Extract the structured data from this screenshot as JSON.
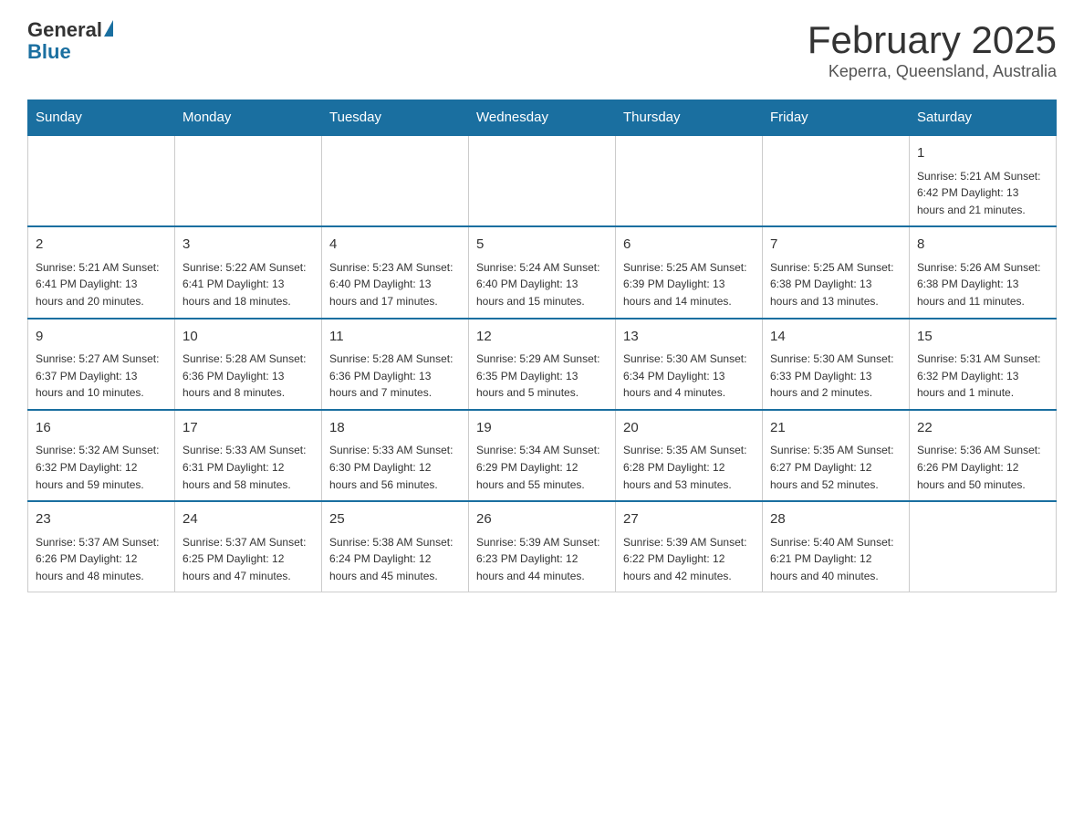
{
  "header": {
    "logo_general": "General",
    "logo_blue": "Blue",
    "title": "February 2025",
    "location": "Keperra, Queensland, Australia"
  },
  "weekdays": [
    "Sunday",
    "Monday",
    "Tuesday",
    "Wednesday",
    "Thursday",
    "Friday",
    "Saturday"
  ],
  "weeks": [
    [
      {
        "day": "",
        "info": ""
      },
      {
        "day": "",
        "info": ""
      },
      {
        "day": "",
        "info": ""
      },
      {
        "day": "",
        "info": ""
      },
      {
        "day": "",
        "info": ""
      },
      {
        "day": "",
        "info": ""
      },
      {
        "day": "1",
        "info": "Sunrise: 5:21 AM\nSunset: 6:42 PM\nDaylight: 13 hours and 21 minutes."
      }
    ],
    [
      {
        "day": "2",
        "info": "Sunrise: 5:21 AM\nSunset: 6:41 PM\nDaylight: 13 hours and 20 minutes."
      },
      {
        "day": "3",
        "info": "Sunrise: 5:22 AM\nSunset: 6:41 PM\nDaylight: 13 hours and 18 minutes."
      },
      {
        "day": "4",
        "info": "Sunrise: 5:23 AM\nSunset: 6:40 PM\nDaylight: 13 hours and 17 minutes."
      },
      {
        "day": "5",
        "info": "Sunrise: 5:24 AM\nSunset: 6:40 PM\nDaylight: 13 hours and 15 minutes."
      },
      {
        "day": "6",
        "info": "Sunrise: 5:25 AM\nSunset: 6:39 PM\nDaylight: 13 hours and 14 minutes."
      },
      {
        "day": "7",
        "info": "Sunrise: 5:25 AM\nSunset: 6:38 PM\nDaylight: 13 hours and 13 minutes."
      },
      {
        "day": "8",
        "info": "Sunrise: 5:26 AM\nSunset: 6:38 PM\nDaylight: 13 hours and 11 minutes."
      }
    ],
    [
      {
        "day": "9",
        "info": "Sunrise: 5:27 AM\nSunset: 6:37 PM\nDaylight: 13 hours and 10 minutes."
      },
      {
        "day": "10",
        "info": "Sunrise: 5:28 AM\nSunset: 6:36 PM\nDaylight: 13 hours and 8 minutes."
      },
      {
        "day": "11",
        "info": "Sunrise: 5:28 AM\nSunset: 6:36 PM\nDaylight: 13 hours and 7 minutes."
      },
      {
        "day": "12",
        "info": "Sunrise: 5:29 AM\nSunset: 6:35 PM\nDaylight: 13 hours and 5 minutes."
      },
      {
        "day": "13",
        "info": "Sunrise: 5:30 AM\nSunset: 6:34 PM\nDaylight: 13 hours and 4 minutes."
      },
      {
        "day": "14",
        "info": "Sunrise: 5:30 AM\nSunset: 6:33 PM\nDaylight: 13 hours and 2 minutes."
      },
      {
        "day": "15",
        "info": "Sunrise: 5:31 AM\nSunset: 6:32 PM\nDaylight: 13 hours and 1 minute."
      }
    ],
    [
      {
        "day": "16",
        "info": "Sunrise: 5:32 AM\nSunset: 6:32 PM\nDaylight: 12 hours and 59 minutes."
      },
      {
        "day": "17",
        "info": "Sunrise: 5:33 AM\nSunset: 6:31 PM\nDaylight: 12 hours and 58 minutes."
      },
      {
        "day": "18",
        "info": "Sunrise: 5:33 AM\nSunset: 6:30 PM\nDaylight: 12 hours and 56 minutes."
      },
      {
        "day": "19",
        "info": "Sunrise: 5:34 AM\nSunset: 6:29 PM\nDaylight: 12 hours and 55 minutes."
      },
      {
        "day": "20",
        "info": "Sunrise: 5:35 AM\nSunset: 6:28 PM\nDaylight: 12 hours and 53 minutes."
      },
      {
        "day": "21",
        "info": "Sunrise: 5:35 AM\nSunset: 6:27 PM\nDaylight: 12 hours and 52 minutes."
      },
      {
        "day": "22",
        "info": "Sunrise: 5:36 AM\nSunset: 6:26 PM\nDaylight: 12 hours and 50 minutes."
      }
    ],
    [
      {
        "day": "23",
        "info": "Sunrise: 5:37 AM\nSunset: 6:26 PM\nDaylight: 12 hours and 48 minutes."
      },
      {
        "day": "24",
        "info": "Sunrise: 5:37 AM\nSunset: 6:25 PM\nDaylight: 12 hours and 47 minutes."
      },
      {
        "day": "25",
        "info": "Sunrise: 5:38 AM\nSunset: 6:24 PM\nDaylight: 12 hours and 45 minutes."
      },
      {
        "day": "26",
        "info": "Sunrise: 5:39 AM\nSunset: 6:23 PM\nDaylight: 12 hours and 44 minutes."
      },
      {
        "day": "27",
        "info": "Sunrise: 5:39 AM\nSunset: 6:22 PM\nDaylight: 12 hours and 42 minutes."
      },
      {
        "day": "28",
        "info": "Sunrise: 5:40 AM\nSunset: 6:21 PM\nDaylight: 12 hours and 40 minutes."
      },
      {
        "day": "",
        "info": ""
      }
    ]
  ]
}
